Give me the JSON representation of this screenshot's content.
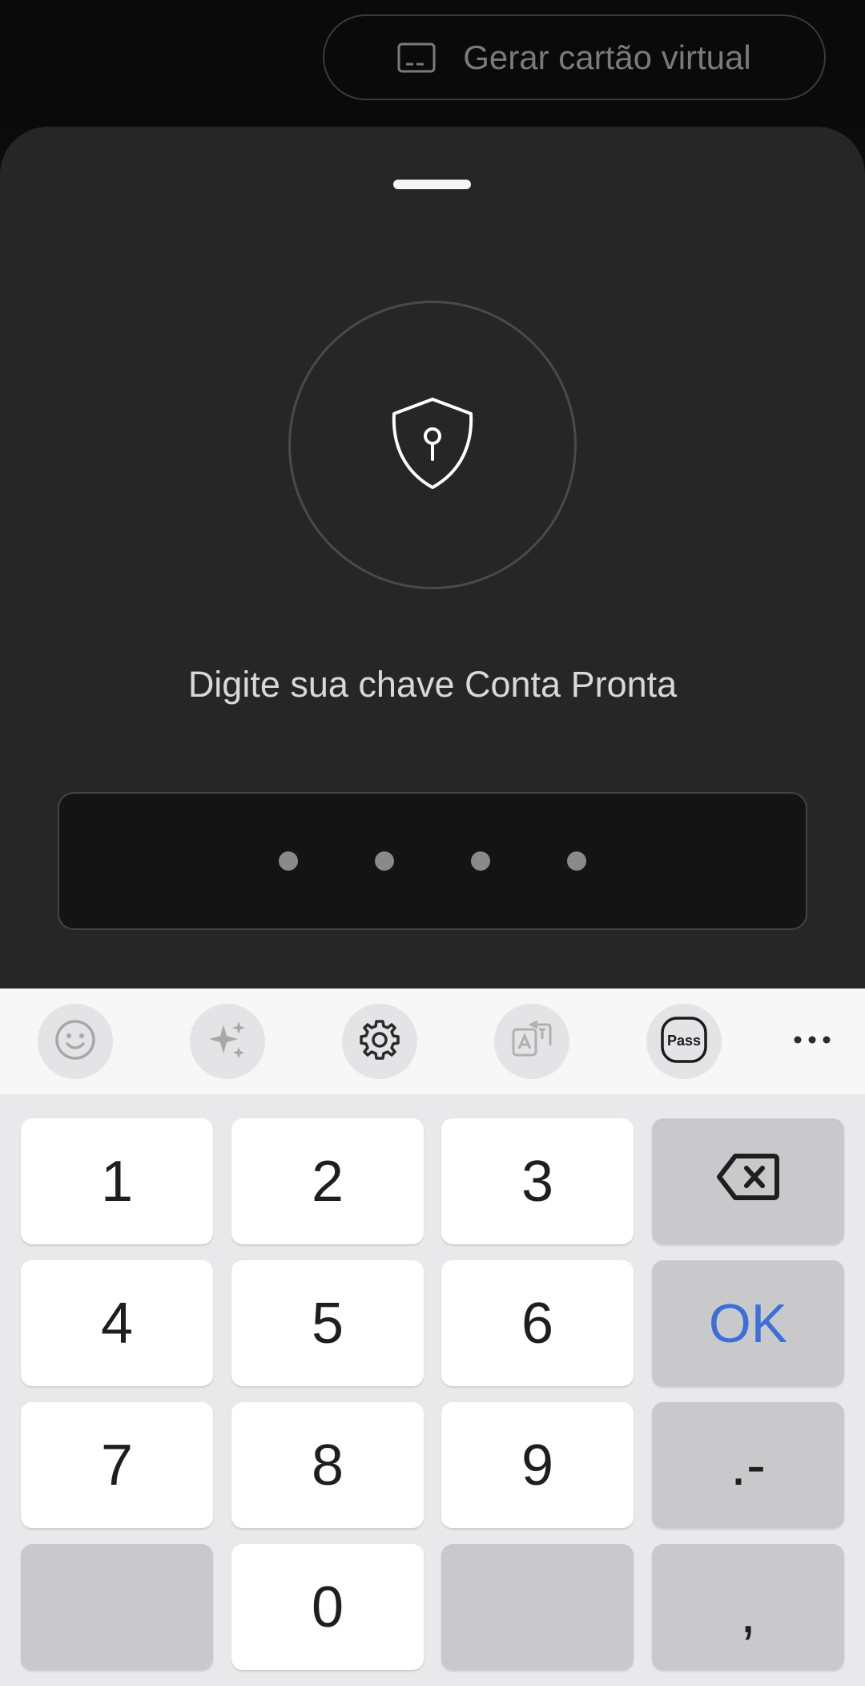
{
  "top": {
    "virtual_card_label": "Gerar cartão virtual",
    "virtual_card_icon": "card-icon"
  },
  "sheet": {
    "prompt": "Digite sua chave Conta Pronta",
    "shield_icon": "shield-key-icon",
    "pin_length": 4
  },
  "keyboard": {
    "toolbar": [
      {
        "name": "emoji-icon"
      },
      {
        "name": "sparkle-icon"
      },
      {
        "name": "gear-icon"
      },
      {
        "name": "translate-icon"
      },
      {
        "name": "pass-icon",
        "label": "Pass"
      },
      {
        "name": "more-icon"
      }
    ],
    "keys": {
      "k1": "1",
      "k2": "2",
      "k3": "3",
      "k4": "4",
      "k5": "5",
      "k6": "6",
      "k7": "7",
      "k8": "8",
      "k9": "9",
      "k0": "0",
      "ok": "OK",
      "dot_dash": ".-",
      "comma": ","
    },
    "accent_color": "#3c70d6"
  }
}
